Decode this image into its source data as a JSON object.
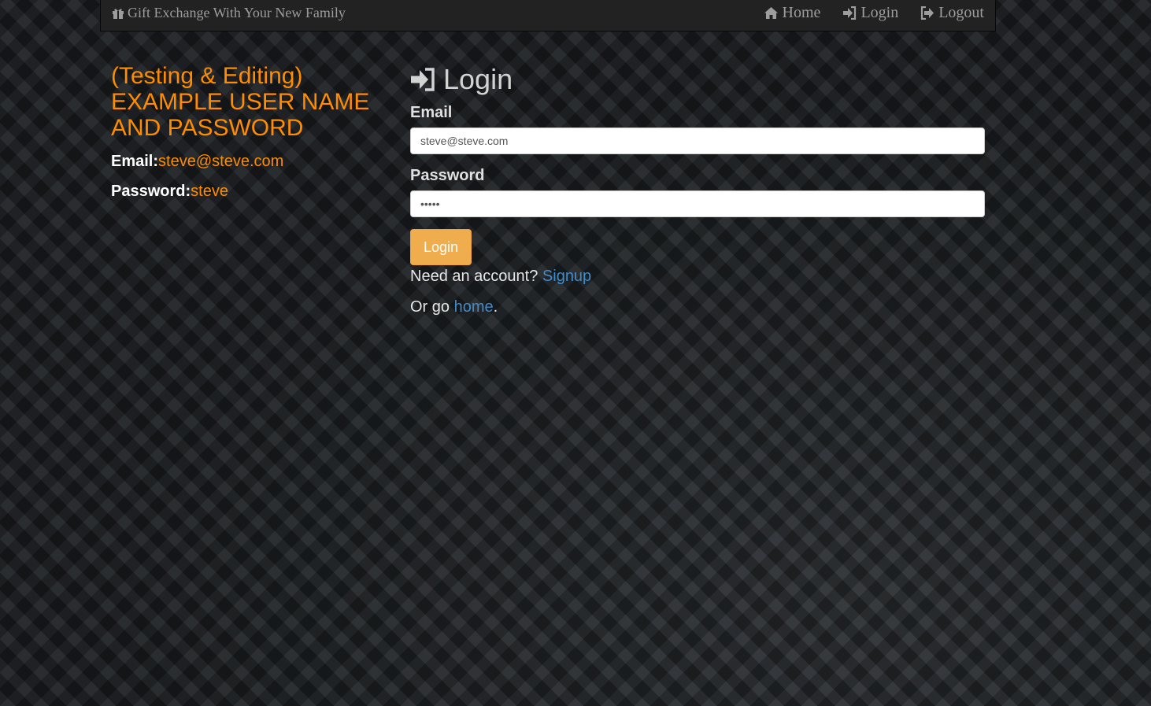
{
  "navbar": {
    "brand": "Gift Exchange With Your New Family",
    "brand_icon": "gift-icon",
    "links": [
      {
        "label": "Home",
        "icon": "home-icon"
      },
      {
        "label": "Login",
        "icon": "sign-in-icon"
      },
      {
        "label": "Logout",
        "icon": "sign-out-icon"
      }
    ]
  },
  "example": {
    "title": "(Testing & Editing) EXAMPLE USER NAME AND PASSWORD",
    "email_label": "Email:",
    "email_value": "steve@steve.com",
    "password_label": "Password:",
    "password_value": "steve"
  },
  "login": {
    "heading": "Login",
    "heading_icon": "sign-in-icon",
    "email_label": "Email",
    "email_value": "steve@steve.com",
    "password_label": "Password",
    "password_value": "steve",
    "submit_label": "Login",
    "need_account_text": "Need an account?",
    "signup_link": "Signup",
    "or_go_text": "Or go",
    "home_link": "home",
    "period": "."
  },
  "colors": {
    "accent_orange": "#ff8c00",
    "button_warning": "#f0ad4e",
    "link_blue": "#428bca",
    "navbar_bg": "#222222"
  }
}
